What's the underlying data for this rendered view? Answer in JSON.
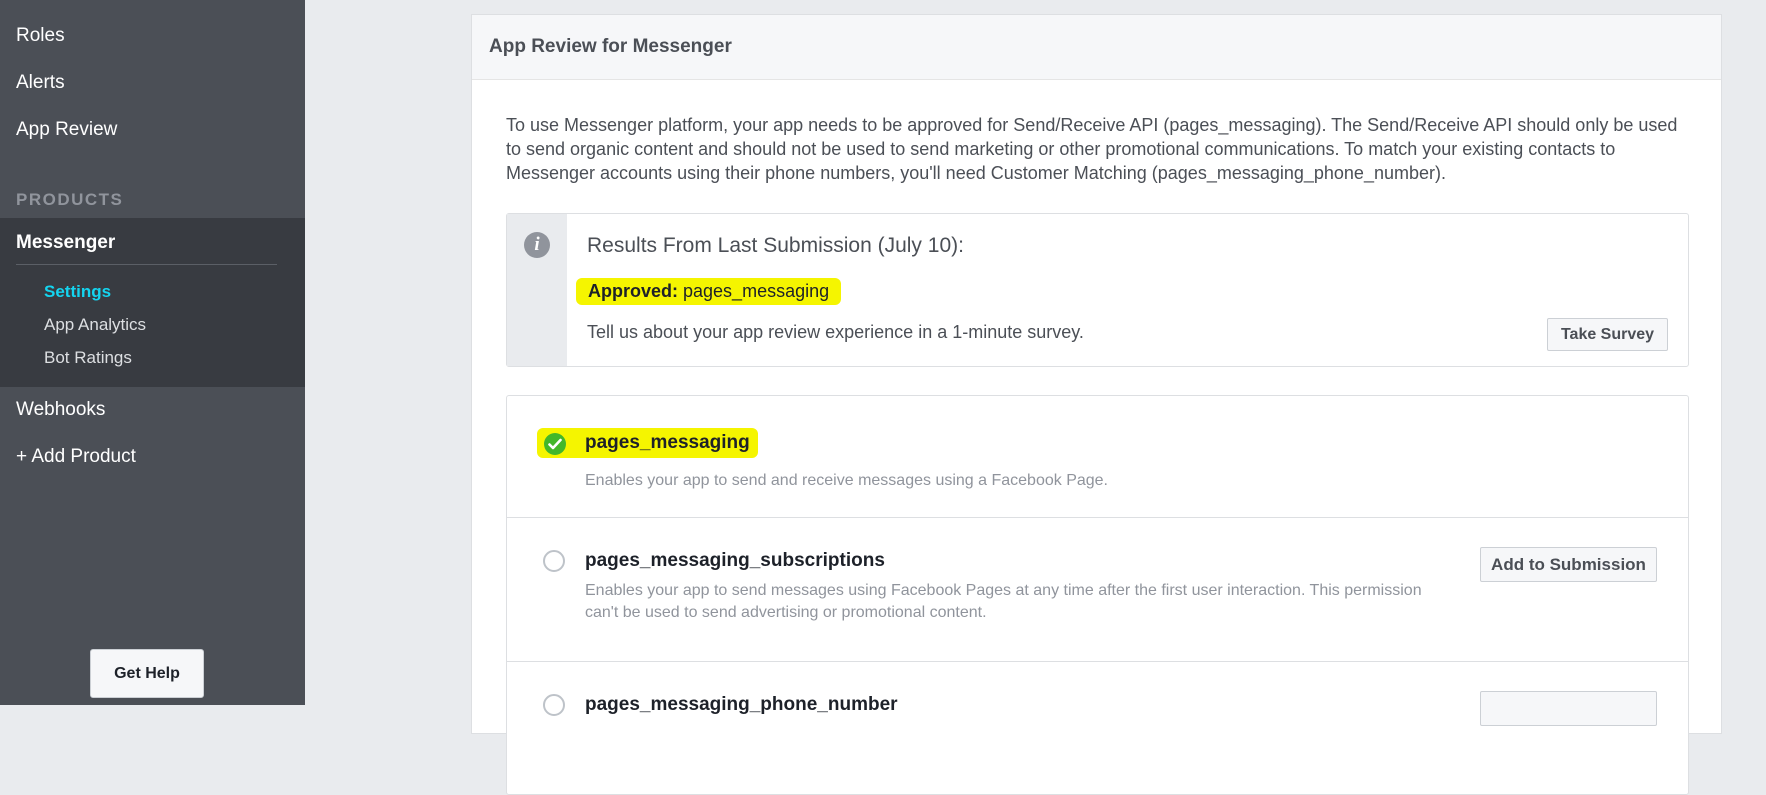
{
  "sidebar": {
    "nav_top": [
      "Roles",
      "Alerts",
      "App Review"
    ],
    "products_header": "PRODUCTS",
    "messenger": {
      "title": "Messenger",
      "sub_items": [
        "Settings",
        "App Analytics",
        "Bot Ratings"
      ],
      "active_sub_item": "Settings"
    },
    "nav_bottom": [
      "Webhooks",
      "+ Add Product"
    ],
    "get_help": "Get Help"
  },
  "panel": {
    "title": "App Review for Messenger",
    "intro": "To use Messenger platform, your app needs to be approved for Send/Receive API (pages_messaging). The Send/Receive API should only be used to send organic content and should not be used to send marketing or other promotional communications. To match your existing contacts to Messenger accounts using their phone numbers, you'll need Customer Matching (pages_messaging_phone_number).",
    "results": {
      "icon": "info-icon",
      "title": "Results From Last Submission (July 10):",
      "approved_label": "Approved:",
      "approved_value": "pages_messaging",
      "survey_text": "Tell us about your app review experience in a 1-minute survey.",
      "survey_button": "Take Survey"
    },
    "permissions": [
      {
        "name": "pages_messaging",
        "description": "Enables your app to send and receive messages using a Facebook Page.",
        "status": "approved"
      },
      {
        "name": "pages_messaging_subscriptions",
        "description": "Enables your app to send messages using Facebook Pages at any time after the first user interaction. This permission can't be used to send advertising or promotional content.",
        "status": "not-submitted",
        "button": "Add to Submission"
      },
      {
        "name": "pages_messaging_phone_number",
        "status": "not-submitted"
      }
    ]
  },
  "colors": {
    "sidebar_bg": "#4b4f56",
    "messenger_block_bg": "#383b41",
    "active_link": "#14d4ef",
    "highlight": "#f5f500",
    "approved_green": "#42b72a"
  }
}
